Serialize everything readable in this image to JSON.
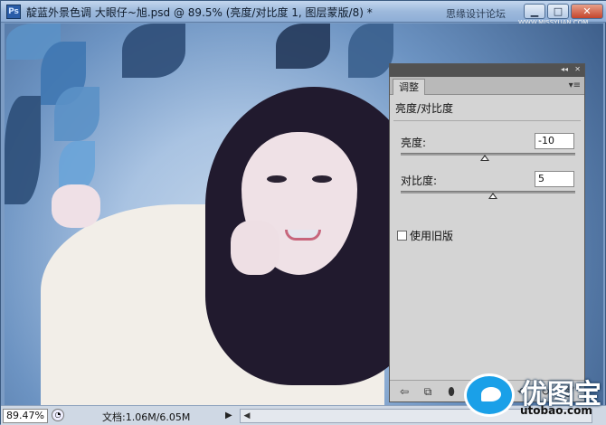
{
  "window": {
    "app_icon_label": "Ps",
    "title": "靛蓝外景色调 大眼仔~旭.psd @ 89.5% (亮度/对比度 1, 图层蒙版/8) *",
    "watermark_site": "思缘设计论坛",
    "watermark_url": "WWW.MISSYUAN.COM",
    "controls": {
      "minimize": "▁",
      "maximize": "□",
      "close": "✕"
    }
  },
  "panel": {
    "tab_label": "调整",
    "menu_icon": "▾≡",
    "collapse_icon": "◂◂",
    "close_icon": "✕",
    "heading": "亮度/对比度",
    "brightness": {
      "label": "亮度:",
      "value": "-10",
      "slider_fraction": 0.48
    },
    "contrast": {
      "label": "对比度:",
      "value": "5",
      "slider_fraction": 0.53
    },
    "legacy_checkbox": {
      "label": "使用旧版",
      "checked": false
    },
    "footer_icons": [
      "back-arrow-icon",
      "expand-view-icon",
      "clip-layer-icon",
      "visibility-eye-icon",
      "view-previous-icon",
      "reset-icon",
      "trash-icon"
    ]
  },
  "statusbar": {
    "zoom": "89.47%",
    "doc_info": "文档:1.06M/6.05M",
    "arrow": "▶",
    "scroll_left": "◀"
  },
  "brand": {
    "name": "优图宝",
    "url": "utobao.com"
  },
  "colors": {
    "titlebar": "#9db9dc",
    "panel_bg": "#d4d4d4",
    "panel_topbar": "#525252",
    "brand_blue": "#1aa0e8"
  }
}
